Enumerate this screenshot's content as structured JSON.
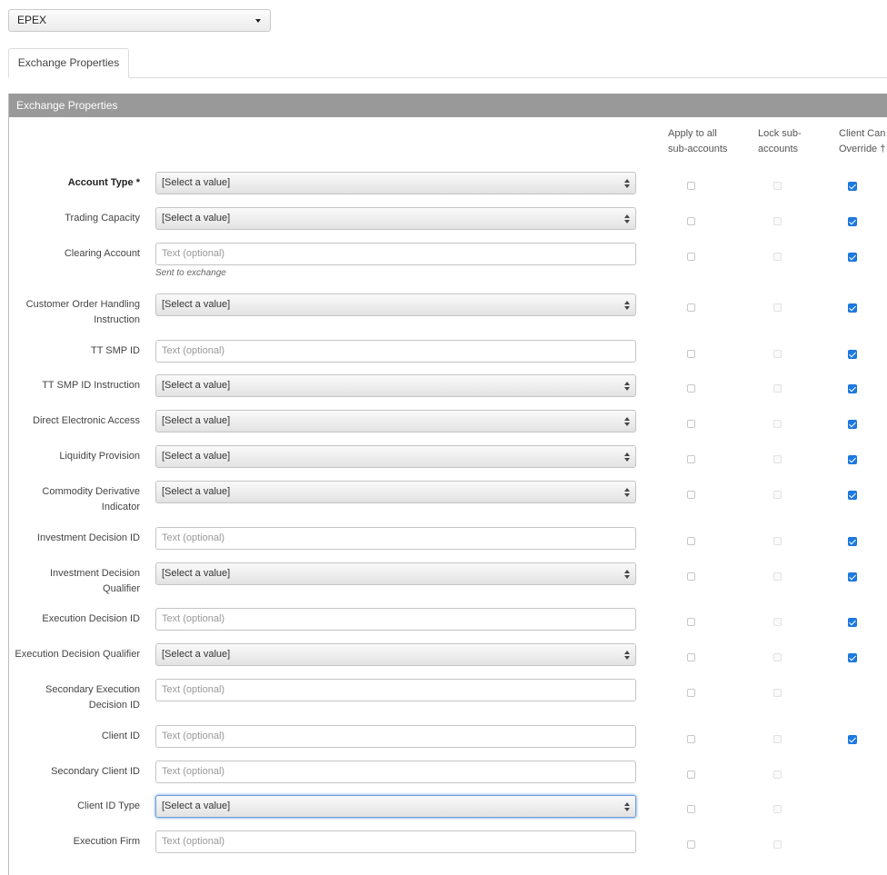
{
  "exchange_select": {
    "value": "EPEX"
  },
  "tabs": [
    {
      "label": "Exchange Properties"
    }
  ],
  "panel": {
    "title": "Exchange Properties"
  },
  "columns": {
    "apply_all": [
      "Apply to all",
      "sub-accounts"
    ],
    "lock_sub": [
      "Lock sub-",
      "accounts"
    ],
    "client_override": [
      "Client Can",
      "Override †"
    ]
  },
  "placeholders": {
    "select": "[Select a value]",
    "text": "Text (optional)"
  },
  "rows": [
    {
      "label": [
        "Account Type *"
      ],
      "type": "select",
      "bold": true,
      "override": true
    },
    {
      "label": [
        "Trading Capacity"
      ],
      "type": "select",
      "override": true
    },
    {
      "label": [
        "Clearing Account"
      ],
      "type": "text",
      "hint": "Sent to exchange",
      "override": true
    },
    {
      "label": [
        "Customer Order Handling",
        "Instruction"
      ],
      "type": "select",
      "override": true
    },
    {
      "label": [
        "TT SMP ID"
      ],
      "type": "text",
      "override": true
    },
    {
      "label": [
        "TT SMP ID Instruction"
      ],
      "type": "select",
      "override": true
    },
    {
      "label": [
        "Direct Electronic Access"
      ],
      "type": "select",
      "override": true
    },
    {
      "label": [
        "Liquidity Provision"
      ],
      "type": "select",
      "override": true
    },
    {
      "label": [
        "Commodity Derivative",
        "Indicator"
      ],
      "type": "select",
      "override": true
    },
    {
      "label": [
        "Investment Decision ID"
      ],
      "type": "text",
      "override": true
    },
    {
      "label": [
        "Investment Decision",
        "Qualifier"
      ],
      "type": "select",
      "override": true
    },
    {
      "label": [
        "Execution Decision ID"
      ],
      "type": "text",
      "override": true
    },
    {
      "label": [
        "Execution Decision Qualifier"
      ],
      "type": "select",
      "override": true
    },
    {
      "label": [
        "Secondary Execution",
        "Decision ID"
      ],
      "type": "text",
      "override": false
    },
    {
      "label": [
        "Client ID"
      ],
      "type": "text",
      "override": true
    },
    {
      "label": [
        "Secondary Client ID"
      ],
      "type": "text",
      "override": false
    },
    {
      "label": [
        "Client ID Type"
      ],
      "type": "select",
      "focused": true,
      "override": false
    },
    {
      "label": [
        "Execution Firm"
      ],
      "type": "text",
      "override": false
    }
  ],
  "colors": {
    "header_bg": "#999999",
    "check_blue": "#1d7be2",
    "focus_border": "#6e9fd8"
  }
}
